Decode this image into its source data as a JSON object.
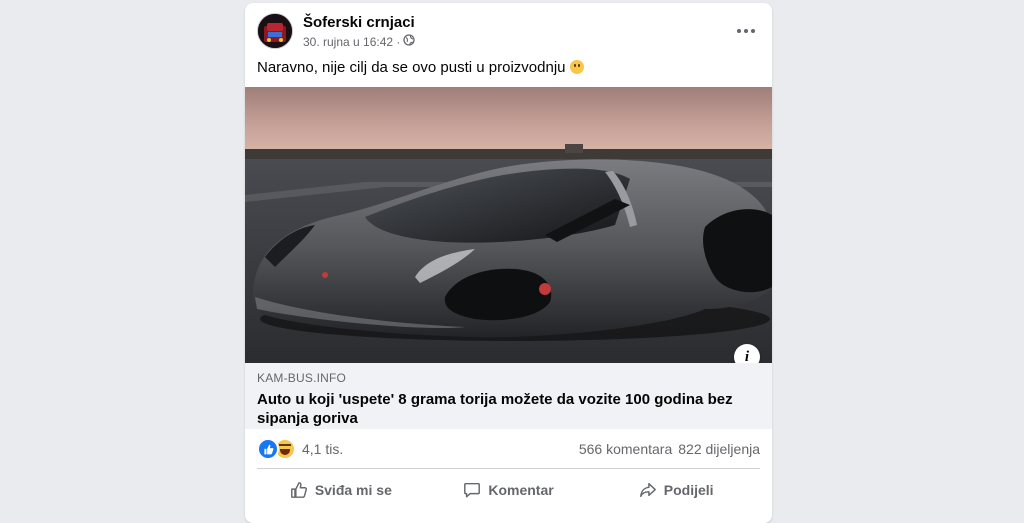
{
  "post": {
    "author": "Šoferski crnjaci",
    "timestamp": "30. rujna u 16:42 ·",
    "privacy_icon": "globe-icon",
    "text": "Naravno, nije cilj da se ovo pusti u proizvodnju",
    "text_emoji": "slightly-smiling-face"
  },
  "link": {
    "image_icon": "concept-car-photo",
    "domain": "KAM-BUS.INFO",
    "headline": "Auto u koji 'uspete' 8 grama torija možete da vozite 100 godina bez sipanja goriva"
  },
  "stats": {
    "reaction_types": [
      "like",
      "haha"
    ],
    "reactions": "4,1 tis.",
    "comments": "566 komentara",
    "shares": "822 dijeljenja"
  },
  "actions": {
    "like": "Sviđa mi se",
    "comment": "Komentar",
    "share": "Podijeli"
  },
  "colors": {
    "accent": "#1877f2",
    "secondary_text": "#65676b",
    "caption_bg": "#f0f2f5"
  }
}
